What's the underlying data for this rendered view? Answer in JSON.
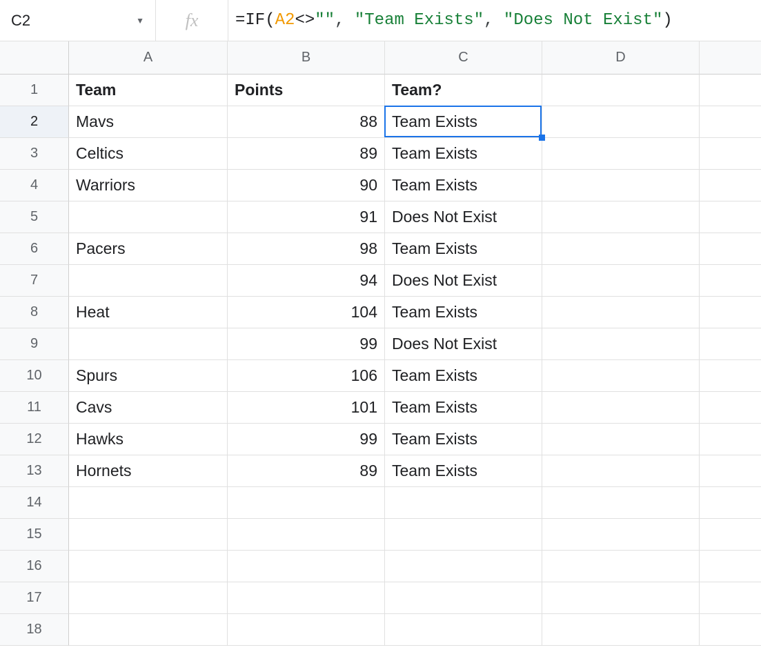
{
  "nameBox": {
    "value": "C2"
  },
  "fxLabel": "fx",
  "formula": {
    "eq": "=",
    "fn": "IF",
    "open": "(",
    "ref": "A2",
    "op": "<>",
    "str1": "\"\"",
    "comma1": ", ",
    "str2": "\"Team Exists\"",
    "comma2": ", ",
    "str3": "\"Does Not Exist\"",
    "close": ")"
  },
  "columns": [
    "A",
    "B",
    "C",
    "D",
    ""
  ],
  "rowCount": 18,
  "headers": {
    "A": "Team",
    "B": "Points",
    "C": "Team?"
  },
  "rows": [
    {
      "A": "Mavs",
      "B": "88",
      "C": "Team Exists"
    },
    {
      "A": "Celtics",
      "B": "89",
      "C": "Team Exists"
    },
    {
      "A": "Warriors",
      "B": "90",
      "C": "Team Exists"
    },
    {
      "A": "",
      "B": "91",
      "C": "Does Not Exist"
    },
    {
      "A": "Pacers",
      "B": "98",
      "C": "Team Exists"
    },
    {
      "A": "",
      "B": "94",
      "C": "Does Not Exist"
    },
    {
      "A": "Heat",
      "B": "104",
      "C": "Team Exists"
    },
    {
      "A": "",
      "B": "99",
      "C": "Does Not Exist"
    },
    {
      "A": "Spurs",
      "B": "106",
      "C": "Team Exists"
    },
    {
      "A": "Cavs",
      "B": "101",
      "C": "Team Exists"
    },
    {
      "A": "Hawks",
      "B": "99",
      "C": "Team Exists"
    },
    {
      "A": "Hornets",
      "B": "89",
      "C": "Team Exists"
    }
  ],
  "activeCell": {
    "row": 2,
    "col": "C"
  }
}
